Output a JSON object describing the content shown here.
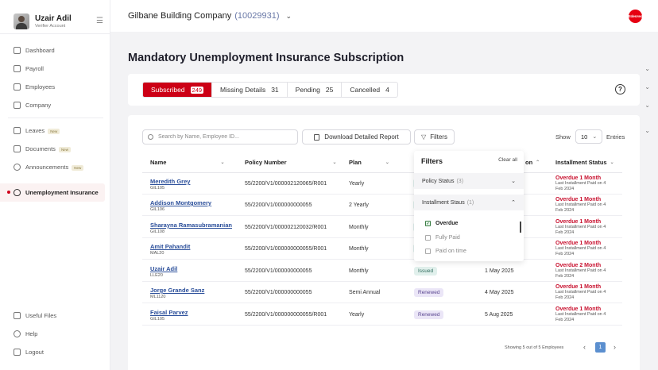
{
  "user": {
    "name": "Uzair Adil",
    "role": "Verifier Account"
  },
  "sidebar": {
    "items": [
      {
        "label": "Dashboard",
        "chevron": false,
        "badge": ""
      },
      {
        "label": "Payroll",
        "chevron": true,
        "badge": ""
      },
      {
        "label": "Employees",
        "chevron": true,
        "badge": ""
      },
      {
        "label": "Company",
        "chevron": true,
        "badge": ""
      },
      {
        "label": "Leaves",
        "chevron": true,
        "badge": "New"
      },
      {
        "label": "Documents",
        "chevron": false,
        "badge": "New"
      },
      {
        "label": "Announcements",
        "chevron": false,
        "badge": "New"
      },
      {
        "label": "Unemployment Insurance",
        "chevron": false,
        "badge": ""
      }
    ],
    "bottom": [
      {
        "label": "Useful Files"
      },
      {
        "label": "Help"
      },
      {
        "label": "Logout"
      }
    ]
  },
  "header": {
    "company": "Gilbane Building Company",
    "company_id": "(10029931)",
    "logo_text": "Edenred"
  },
  "page": {
    "title": "Mandatory Unemployment Insurance Subscription"
  },
  "tabs": [
    {
      "label": "Subscribed",
      "count": "249"
    },
    {
      "label": "Missing Details",
      "count": "31"
    },
    {
      "label": "Pending",
      "count": "25"
    },
    {
      "label": "Cancelled",
      "count": "4"
    }
  ],
  "toolbar": {
    "search_placeholder": "Search by Name, Employee ID...",
    "download_label": "Download Detailed Report",
    "filters_label": "Filters",
    "show_label": "Show",
    "show_value": "10",
    "entries_label": "Entries"
  },
  "table": {
    "columns": [
      "Name",
      "Policy Number",
      "Plan",
      "on",
      "Installment Status"
    ],
    "rows": [
      {
        "name": "Meredith Grey",
        "id": "GIL105",
        "policy": "55/2200/V1/000002120065/R001",
        "plan": "Yearly",
        "status": "",
        "date": "",
        "inst": "Overdue 1 Month",
        "inst_sub1": "Last Installment Paid on 4",
        "inst_sub2": "Feb 2024"
      },
      {
        "name": "Addison Montgomery",
        "id": "GIL106",
        "policy": "55/2200/V1/000000000055",
        "plan": "2 Yearly",
        "status": "",
        "date": "",
        "inst": "Overdue 1 Month",
        "inst_sub1": "Last Installment Paid on 4",
        "inst_sub2": "Feb 2024"
      },
      {
        "name": "Sharayna Ramasubramanian",
        "id": "GIL108",
        "policy": "55/2200/V1/000002120032/R001",
        "plan": "Monthly",
        "status": "",
        "date": "",
        "inst": "Overdue 1 Month",
        "inst_sub1": "Last Installment Paid on 4",
        "inst_sub2": "Feb 2024"
      },
      {
        "name": "Amit Pahandit",
        "id": "MAL20",
        "policy": "55/2200/V1/000000000055/R001",
        "plan": "Monthly",
        "status": "",
        "date": "",
        "inst": "Overdue 1 Month",
        "inst_sub1": "Last Installment Paid on 4",
        "inst_sub2": "Feb 2024"
      },
      {
        "name": "Uzair Adil",
        "id": "LLE20",
        "policy": "55/2200/V1/000000000055",
        "plan": "Monthly",
        "status": "Issued",
        "date": "1 May 2025",
        "inst": "Overdue 2 Month",
        "inst_sub1": "Last Installment Paid on 4",
        "inst_sub2": "Feb 2024"
      },
      {
        "name": "Jorge Grande Sanz",
        "id": "ML1120",
        "policy": "55/2200/V1/000000000055",
        "plan": "Semi Annual",
        "status": "Renewed",
        "date": "4 May 2025",
        "inst": "Overdue 1 Month",
        "inst_sub1": "Last Installment Paid on 4",
        "inst_sub2": "Feb 2024"
      },
      {
        "name": "Faisal Parvez",
        "id": "GIL105",
        "policy": "55/2200/V1/000000000055/R001",
        "plan": "Yearly",
        "status": "Renewed",
        "date": "5 Aug 2025",
        "inst": "Overdue 1 Month",
        "inst_sub1": "Last Installment Paid on 4",
        "inst_sub2": "Feb 2024"
      }
    ]
  },
  "pagination": {
    "info": "Showing 5 out of 5 Employees",
    "current": "1"
  },
  "filters": {
    "title": "Filters",
    "clear": "Clear all",
    "sections": [
      {
        "label": "Policy Status",
        "count": "(3)"
      },
      {
        "label": "Installment Staus",
        "count": "(1)"
      }
    ],
    "options": [
      {
        "label": "Overdue",
        "checked": true
      },
      {
        "label": "Fully Paid",
        "checked": false
      },
      {
        "label": "Paid on time",
        "checked": false
      }
    ]
  }
}
